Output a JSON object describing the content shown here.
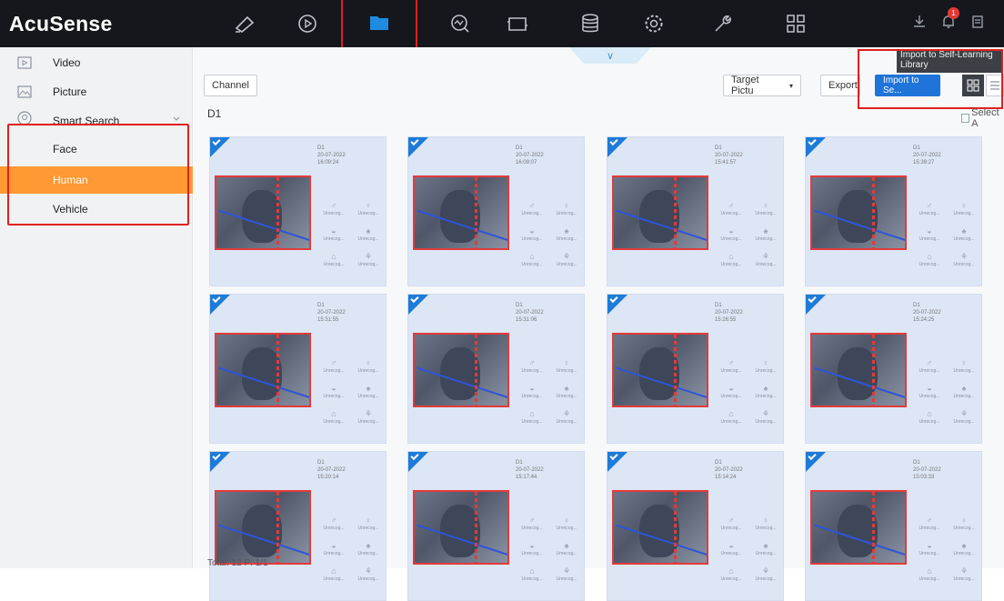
{
  "app": {
    "title": "AcuSense"
  },
  "topnav": {
    "items": [
      {
        "name": "nav-live-view",
        "icon": "camera-icon"
      },
      {
        "name": "nav-playback",
        "icon": "playback-icon"
      },
      {
        "name": "nav-file-management",
        "icon": "folder-icon",
        "active": true
      },
      {
        "name": "nav-smart-analysis",
        "icon": "analysis-icon"
      },
      {
        "name": "nav-display",
        "icon": "display-icon"
      },
      {
        "name": "nav-storage",
        "icon": "storage-icon"
      },
      {
        "name": "nav-configuration",
        "icon": "gear-icon"
      },
      {
        "name": "nav-maintenance",
        "icon": "wrench-icon"
      },
      {
        "name": "nav-more",
        "icon": "grid-icon"
      }
    ],
    "notification_count": "1"
  },
  "sidebar": {
    "items": [
      {
        "label": "Video",
        "icon": "video-icon"
      },
      {
        "label": "Picture",
        "icon": "picture-icon"
      },
      {
        "label": "Smart Search",
        "icon": "smart-search-icon"
      }
    ],
    "sub_items": [
      {
        "label": "Face"
      },
      {
        "label": "Human",
        "selected": true
      },
      {
        "label": "Vehicle"
      }
    ]
  },
  "toolbar": {
    "channel_label": "Channel",
    "target_picture_label": "Target Pictu",
    "export_label": "Export",
    "import_label": "Import to Se...",
    "tooltip": "Import to Self-Learning Library"
  },
  "results": {
    "group_label": "D1",
    "select_all_label": "Select A",
    "cards": [
      {
        "channel": "D1",
        "date": "20-07-2022",
        "time": "16:09:24"
      },
      {
        "channel": "D1",
        "date": "20-07-2022",
        "time": "16:09:07"
      },
      {
        "channel": "D1",
        "date": "20-07-2022",
        "time": "15:41:57"
      },
      {
        "channel": "D1",
        "date": "20-07-2022",
        "time": "15:39:27"
      },
      {
        "channel": "D1",
        "date": "20-07-2022",
        "time": "15:31:55"
      },
      {
        "channel": "D1",
        "date": "20-07-2022",
        "time": "15:31:06"
      },
      {
        "channel": "D1",
        "date": "20-07-2022",
        "time": "15:26:55"
      },
      {
        "channel": "D1",
        "date": "20-07-2022",
        "time": "15:24:25"
      },
      {
        "channel": "D1",
        "date": "20-07-2022",
        "time": "15:20:14"
      },
      {
        "channel": "D1",
        "date": "20-07-2022",
        "time": "15:17:44"
      },
      {
        "channel": "D1",
        "date": "20-07-2022",
        "time": "15:14:24"
      },
      {
        "channel": "D1",
        "date": "20-07-2022",
        "time": "15:03:33"
      }
    ],
    "attr_label": "Unrecog..."
  },
  "footer": {
    "total": "Total: 12  P: 1/1"
  },
  "colors": {
    "accent": "#ff9933",
    "selection": "#1e74d8",
    "highlight_box": "#e02020"
  }
}
